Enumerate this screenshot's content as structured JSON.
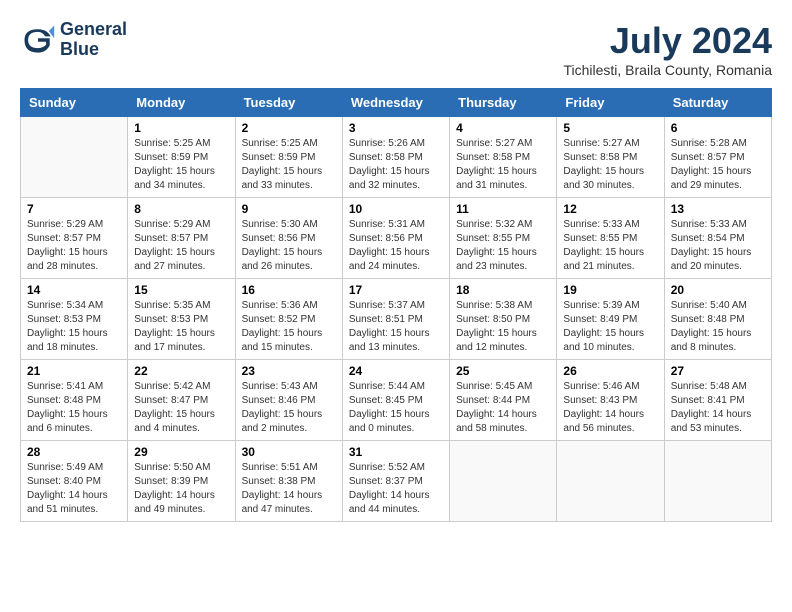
{
  "header": {
    "logo_line1": "General",
    "logo_line2": "Blue",
    "month_year": "July 2024",
    "location": "Tichilesti, Braila County, Romania"
  },
  "weekdays": [
    "Sunday",
    "Monday",
    "Tuesday",
    "Wednesday",
    "Thursday",
    "Friday",
    "Saturday"
  ],
  "weeks": [
    [
      {
        "day": "",
        "info": ""
      },
      {
        "day": "1",
        "info": "Sunrise: 5:25 AM\nSunset: 8:59 PM\nDaylight: 15 hours\nand 34 minutes."
      },
      {
        "day": "2",
        "info": "Sunrise: 5:25 AM\nSunset: 8:59 PM\nDaylight: 15 hours\nand 33 minutes."
      },
      {
        "day": "3",
        "info": "Sunrise: 5:26 AM\nSunset: 8:58 PM\nDaylight: 15 hours\nand 32 minutes."
      },
      {
        "day": "4",
        "info": "Sunrise: 5:27 AM\nSunset: 8:58 PM\nDaylight: 15 hours\nand 31 minutes."
      },
      {
        "day": "5",
        "info": "Sunrise: 5:27 AM\nSunset: 8:58 PM\nDaylight: 15 hours\nand 30 minutes."
      },
      {
        "day": "6",
        "info": "Sunrise: 5:28 AM\nSunset: 8:57 PM\nDaylight: 15 hours\nand 29 minutes."
      }
    ],
    [
      {
        "day": "7",
        "info": "Sunrise: 5:29 AM\nSunset: 8:57 PM\nDaylight: 15 hours\nand 28 minutes."
      },
      {
        "day": "8",
        "info": "Sunrise: 5:29 AM\nSunset: 8:57 PM\nDaylight: 15 hours\nand 27 minutes."
      },
      {
        "day": "9",
        "info": "Sunrise: 5:30 AM\nSunset: 8:56 PM\nDaylight: 15 hours\nand 26 minutes."
      },
      {
        "day": "10",
        "info": "Sunrise: 5:31 AM\nSunset: 8:56 PM\nDaylight: 15 hours\nand 24 minutes."
      },
      {
        "day": "11",
        "info": "Sunrise: 5:32 AM\nSunset: 8:55 PM\nDaylight: 15 hours\nand 23 minutes."
      },
      {
        "day": "12",
        "info": "Sunrise: 5:33 AM\nSunset: 8:55 PM\nDaylight: 15 hours\nand 21 minutes."
      },
      {
        "day": "13",
        "info": "Sunrise: 5:33 AM\nSunset: 8:54 PM\nDaylight: 15 hours\nand 20 minutes."
      }
    ],
    [
      {
        "day": "14",
        "info": "Sunrise: 5:34 AM\nSunset: 8:53 PM\nDaylight: 15 hours\nand 18 minutes."
      },
      {
        "day": "15",
        "info": "Sunrise: 5:35 AM\nSunset: 8:53 PM\nDaylight: 15 hours\nand 17 minutes."
      },
      {
        "day": "16",
        "info": "Sunrise: 5:36 AM\nSunset: 8:52 PM\nDaylight: 15 hours\nand 15 minutes."
      },
      {
        "day": "17",
        "info": "Sunrise: 5:37 AM\nSunset: 8:51 PM\nDaylight: 15 hours\nand 13 minutes."
      },
      {
        "day": "18",
        "info": "Sunrise: 5:38 AM\nSunset: 8:50 PM\nDaylight: 15 hours\nand 12 minutes."
      },
      {
        "day": "19",
        "info": "Sunrise: 5:39 AM\nSunset: 8:49 PM\nDaylight: 15 hours\nand 10 minutes."
      },
      {
        "day": "20",
        "info": "Sunrise: 5:40 AM\nSunset: 8:48 PM\nDaylight: 15 hours\nand 8 minutes."
      }
    ],
    [
      {
        "day": "21",
        "info": "Sunrise: 5:41 AM\nSunset: 8:48 PM\nDaylight: 15 hours\nand 6 minutes."
      },
      {
        "day": "22",
        "info": "Sunrise: 5:42 AM\nSunset: 8:47 PM\nDaylight: 15 hours\nand 4 minutes."
      },
      {
        "day": "23",
        "info": "Sunrise: 5:43 AM\nSunset: 8:46 PM\nDaylight: 15 hours\nand 2 minutes."
      },
      {
        "day": "24",
        "info": "Sunrise: 5:44 AM\nSunset: 8:45 PM\nDaylight: 15 hours\nand 0 minutes."
      },
      {
        "day": "25",
        "info": "Sunrise: 5:45 AM\nSunset: 8:44 PM\nDaylight: 14 hours\nand 58 minutes."
      },
      {
        "day": "26",
        "info": "Sunrise: 5:46 AM\nSunset: 8:43 PM\nDaylight: 14 hours\nand 56 minutes."
      },
      {
        "day": "27",
        "info": "Sunrise: 5:48 AM\nSunset: 8:41 PM\nDaylight: 14 hours\nand 53 minutes."
      }
    ],
    [
      {
        "day": "28",
        "info": "Sunrise: 5:49 AM\nSunset: 8:40 PM\nDaylight: 14 hours\nand 51 minutes."
      },
      {
        "day": "29",
        "info": "Sunrise: 5:50 AM\nSunset: 8:39 PM\nDaylight: 14 hours\nand 49 minutes."
      },
      {
        "day": "30",
        "info": "Sunrise: 5:51 AM\nSunset: 8:38 PM\nDaylight: 14 hours\nand 47 minutes."
      },
      {
        "day": "31",
        "info": "Sunrise: 5:52 AM\nSunset: 8:37 PM\nDaylight: 14 hours\nand 44 minutes."
      },
      {
        "day": "",
        "info": ""
      },
      {
        "day": "",
        "info": ""
      },
      {
        "day": "",
        "info": ""
      }
    ]
  ]
}
